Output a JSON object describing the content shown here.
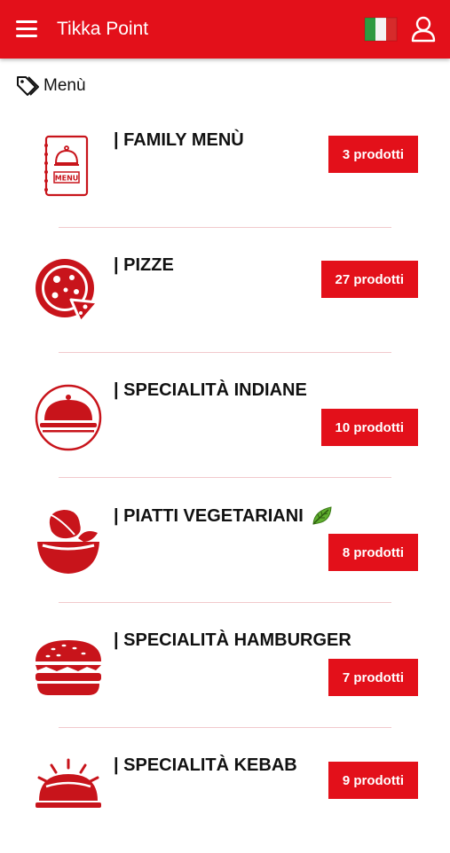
{
  "header": {
    "title": "Tikka Point",
    "menu_icon": "hamburger-menu-icon",
    "language_flag": "italy-flag-icon",
    "account_icon": "user-icon"
  },
  "breadcrumb": {
    "icon": "tag-icon",
    "label": "Menù"
  },
  "categories": [
    {
      "title": "| FAMILY MENÙ",
      "count_label": "3 prodotti",
      "icon": "menu-card-icon"
    },
    {
      "title": "| PIZZE",
      "count_label": "27 prodotti",
      "icon": "pizza-icon"
    },
    {
      "title": "| SPECIALITÀ INDIANE",
      "count_label": "10 prodotti",
      "icon": "cloche-icon"
    },
    {
      "title": "| PIATTI VEGETARIANI",
      "count_label": "8 prodotti",
      "icon": "vegetable-bowl-icon",
      "badge_icon": "leaf-icon"
    },
    {
      "title": "| SPECIALITÀ HAMBURGER",
      "count_label": "7 prodotti",
      "icon": "hamburger-icon"
    },
    {
      "title": "| SPECIALITÀ KEBAB",
      "count_label": "9 prodotti",
      "icon": "kebab-grill-icon"
    }
  ],
  "colors": {
    "primary": "#e3101a",
    "icon_red": "#c8141b",
    "divider": "#f1c9cc",
    "leaf_green": "#5fae2e"
  }
}
